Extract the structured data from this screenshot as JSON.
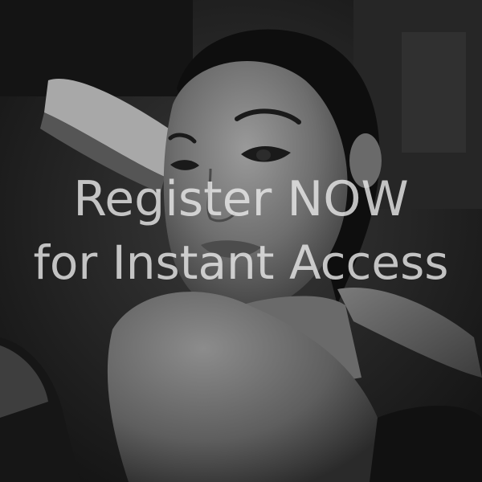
{
  "overlay": {
    "line_1": "Register NOW",
    "line_2": "for Instant Access"
  },
  "colors": {
    "background": "#1a1a1a",
    "text": "#ebebeb"
  }
}
